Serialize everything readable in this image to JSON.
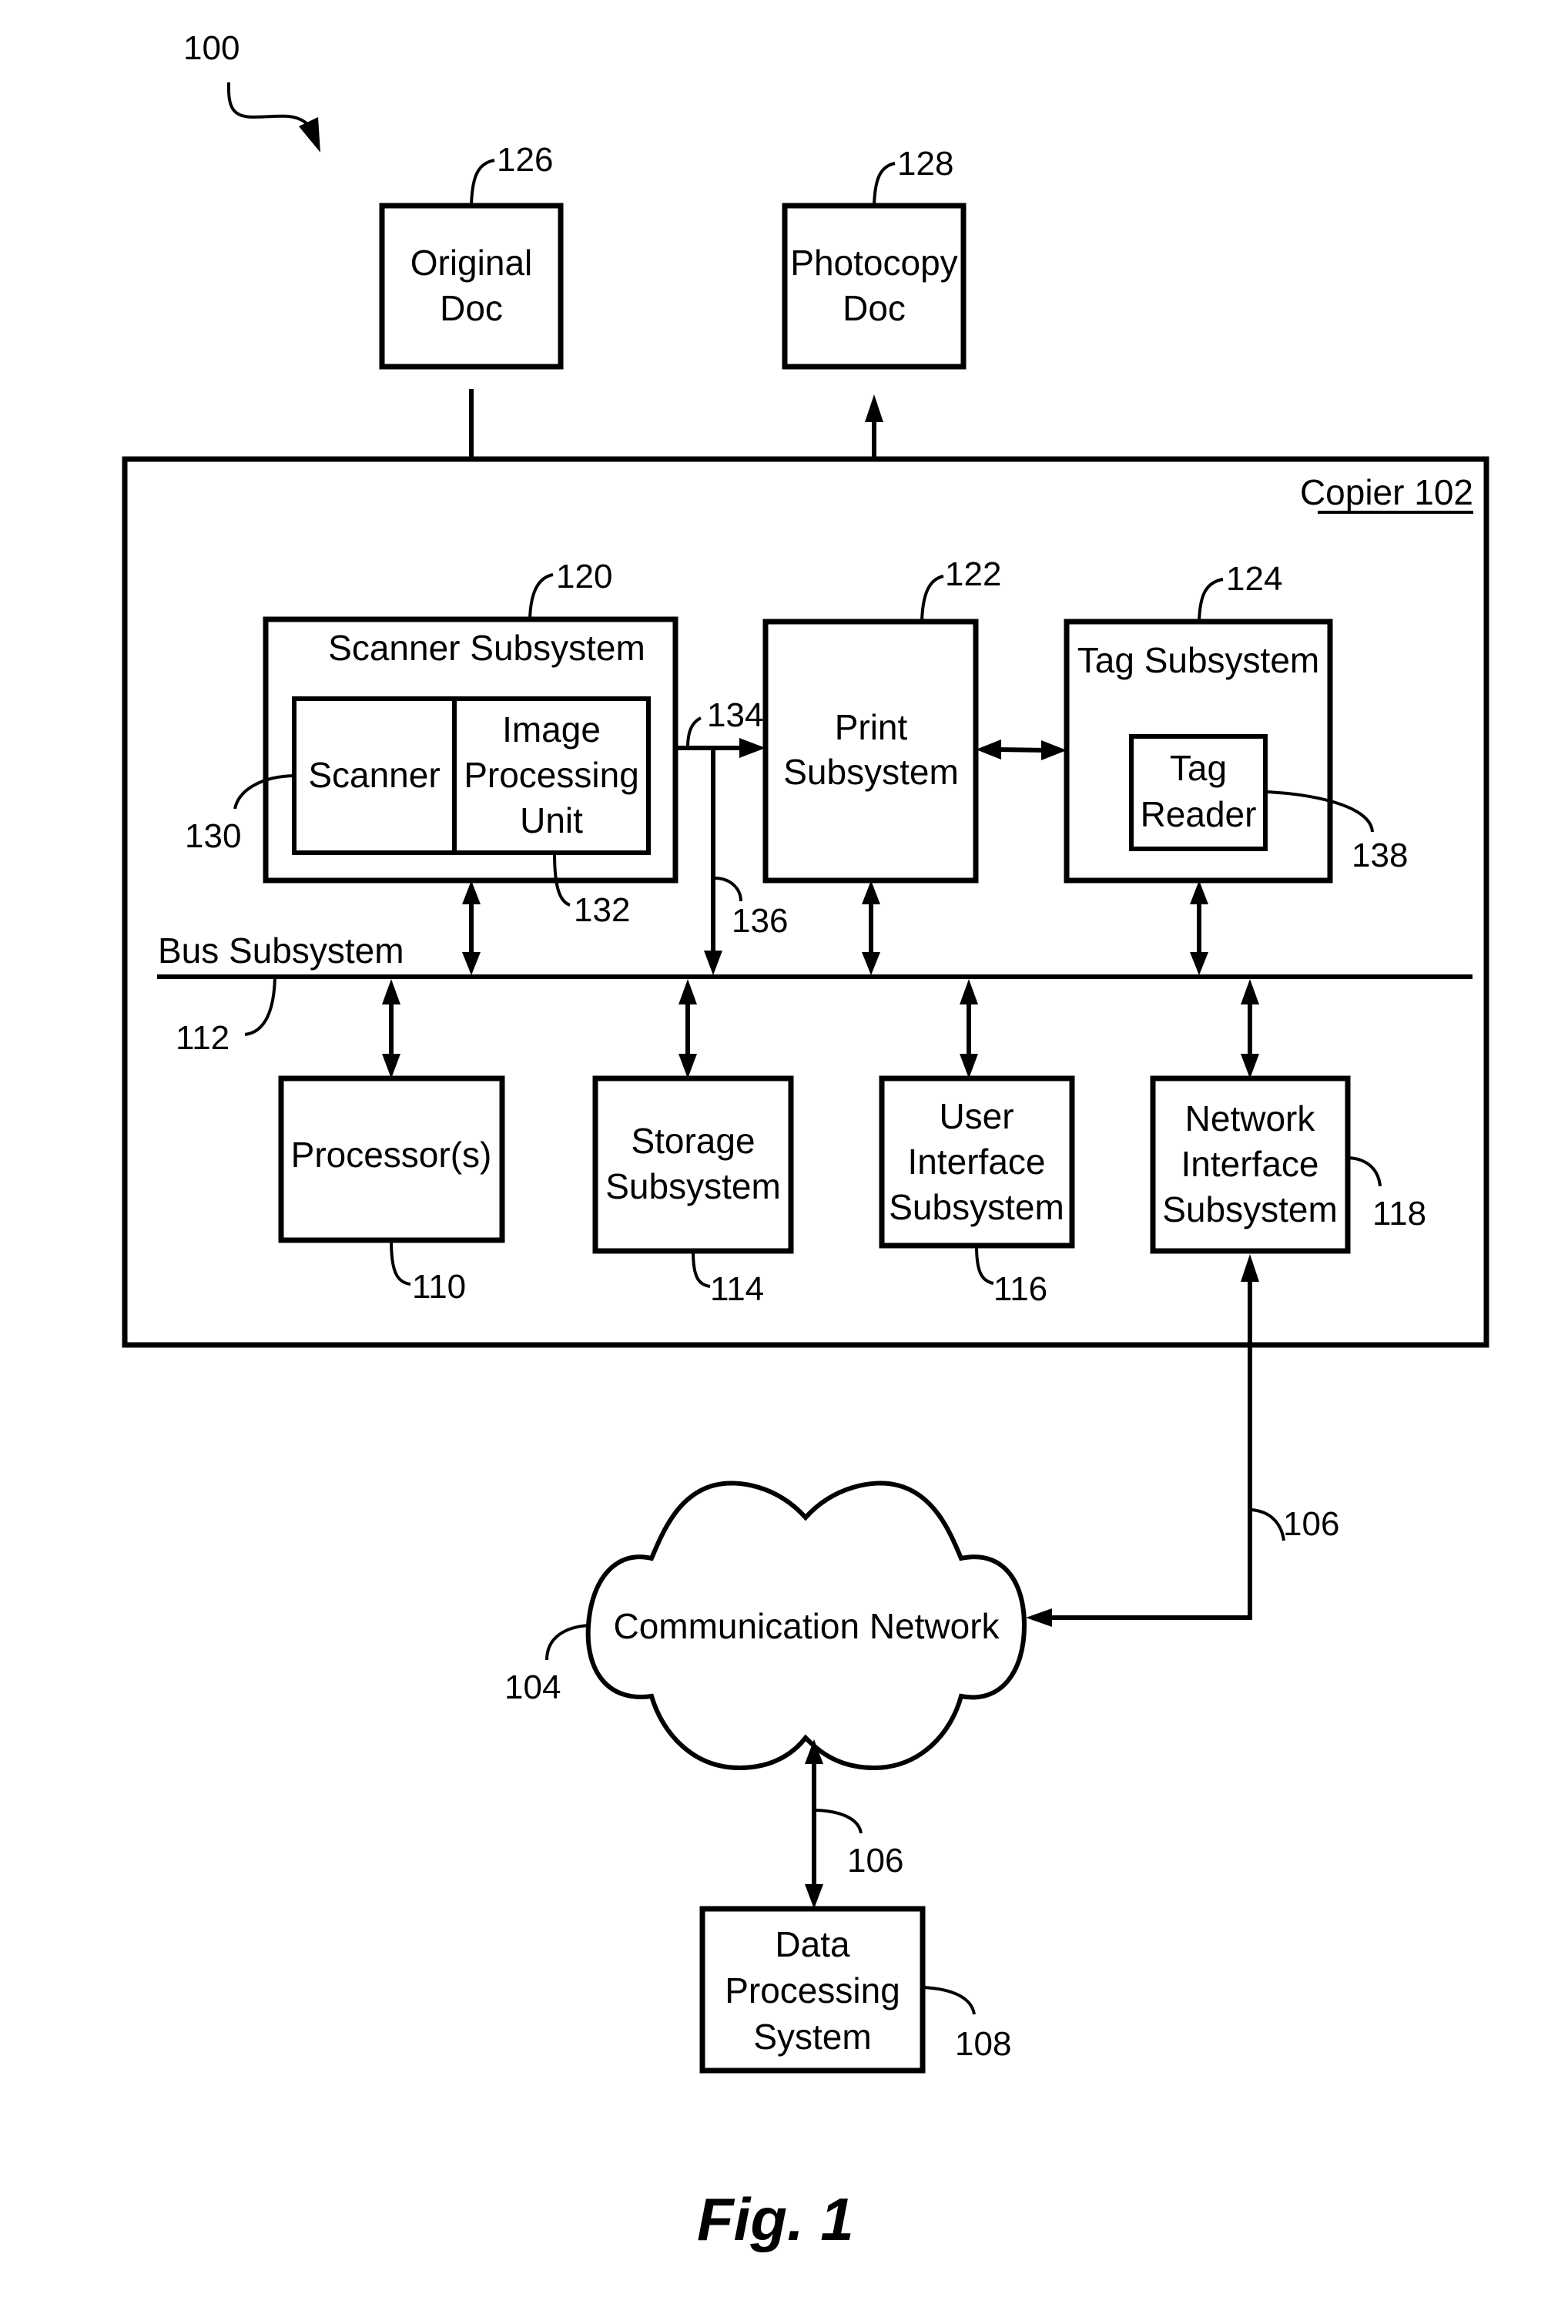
{
  "figure": {
    "caption": "Fig. 1",
    "system_ref": "100",
    "copier_label": "Copier 102"
  },
  "external": {
    "original_doc": {
      "lines": [
        "Original",
        "Doc"
      ],
      "ref": "126"
    },
    "photocopy_doc": {
      "lines": [
        "Photocopy",
        "Doc"
      ],
      "ref": "128"
    }
  },
  "copier": {
    "scanner_subsystem": {
      "title": "Scanner Subsystem",
      "ref": "120",
      "scanner": {
        "label": "Scanner",
        "ref": "130"
      },
      "image_processing_unit": {
        "lines": [
          "Image",
          "Processing",
          "Unit"
        ],
        "ref": "132"
      }
    },
    "print_subsystem": {
      "lines": [
        "Print",
        "Subsystem"
      ],
      "ref": "122"
    },
    "tag_subsystem": {
      "title": "Tag Subsystem",
      "ref": "124",
      "tag_reader": {
        "lines": [
          "Tag",
          "Reader"
        ],
        "ref": "138"
      }
    },
    "path_refs": {
      "scanner_to_print": "134",
      "scanner_to_bus": "136"
    },
    "bus": {
      "label": "Bus Subsystem",
      "ref": "112"
    },
    "processor": {
      "lines": [
        "Processor(s)"
      ],
      "ref": "110"
    },
    "storage": {
      "lines": [
        "Storage",
        "Subsystem"
      ],
      "ref": "114"
    },
    "user_interface": {
      "lines": [
        "User",
        "Interface",
        "Subsystem"
      ],
      "ref": "116"
    },
    "network_interface": {
      "lines": [
        "Network",
        "Interface",
        "Subsystem"
      ],
      "ref": "118"
    }
  },
  "network": {
    "label": "Communication Network",
    "ref": "104",
    "link_ref": "106"
  },
  "data_processing_system": {
    "lines": [
      "Data",
      "Processing",
      "System"
    ],
    "ref": "108"
  }
}
